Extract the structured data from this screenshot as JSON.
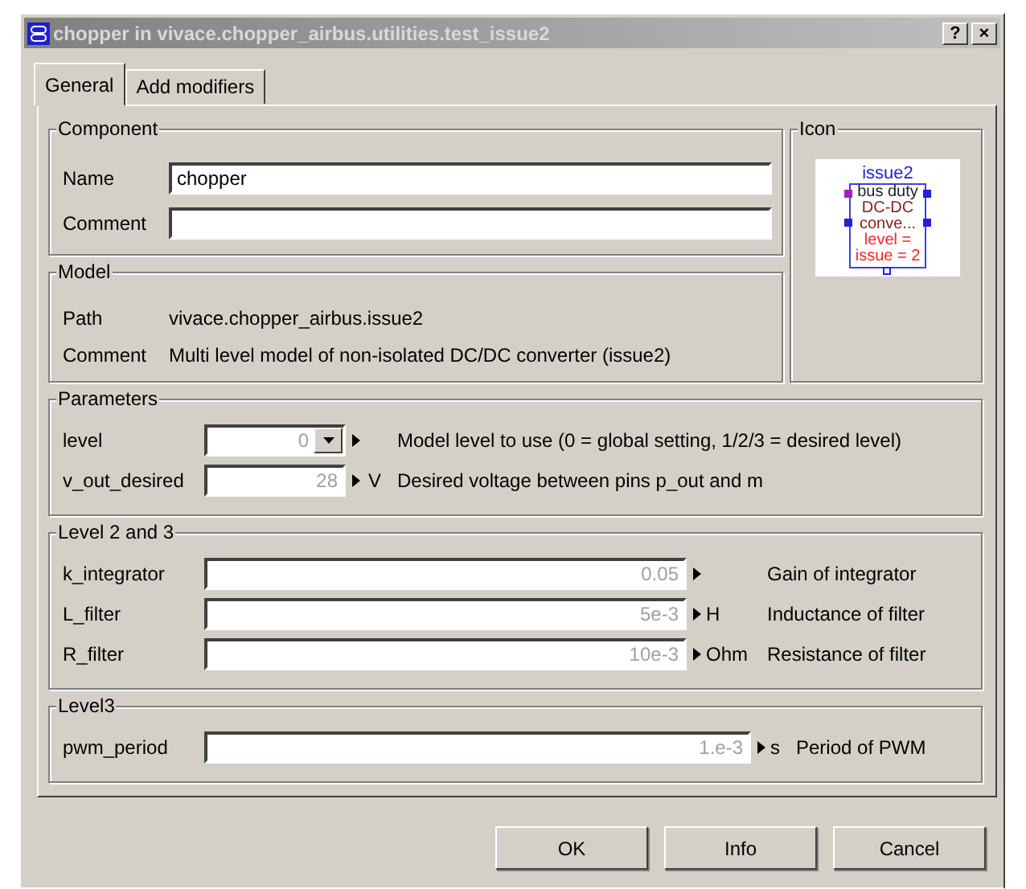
{
  "window": {
    "title": "chopper in vivace.chopper_airbus.utilities.test_issue2",
    "help": "?",
    "close": "×"
  },
  "tabs": [
    {
      "label": "General",
      "selected": true
    },
    {
      "label": "Add modifiers",
      "selected": false
    }
  ],
  "component": {
    "title": "Component",
    "fields": [
      {
        "label": "Name",
        "value": "chopper"
      },
      {
        "label": "Comment"
      }
    ]
  },
  "model": {
    "title": "Model",
    "rows": [
      {
        "label": "Path",
        "value": "vivace.chopper_airbus.issue2"
      },
      {
        "label": "Comment",
        "value": "Multi level model of non-isolated DC/DC converter (issue2)"
      }
    ]
  },
  "icon": {
    "title": "Icon",
    "caption": "issue2",
    "lines": [
      {
        "text": "bus duty",
        "color": "#222222"
      },
      {
        "text": "DC-DC",
        "color": "#8b1a1a"
      },
      {
        "text": "conve...",
        "color": "#8b1a1a"
      },
      {
        "text": "level =",
        "color": "#ff2020"
      },
      {
        "text": "issue = 2",
        "color": "#ff2020"
      }
    ]
  },
  "sections": [
    {
      "title": "Parameters",
      "rows": [
        {
          "kind": "dropdown",
          "name": "level",
          "placeholder": "0",
          "description": "Model level to use (0 = global setting, 1/2/3 = desired level)"
        },
        {
          "kind": "field",
          "name": "v_out_desired",
          "placeholder": "28",
          "unit": "V",
          "description": "Desired voltage between pins p_out and m"
        }
      ]
    },
    {
      "title": "Level 2 and 3",
      "rows": [
        {
          "kind": "field",
          "name": "k_integrator",
          "placeholder": "0.05",
          "description": "Gain of integrator"
        },
        {
          "kind": "field",
          "name": "L_filter",
          "placeholder": "5e-3",
          "unit": "H",
          "description": "Inductance of filter"
        },
        {
          "kind": "field",
          "name": "R_filter",
          "placeholder": "10e-3",
          "unit": "Ohm",
          "description": "Resistance of filter"
        }
      ]
    },
    {
      "title": "Level3",
      "rows": [
        {
          "kind": "field",
          "name": "pwm_period",
          "placeholder": "1.e-3",
          "unit": "s",
          "description": "Period of PWM"
        }
      ]
    }
  ],
  "buttons": [
    "OK",
    "Info",
    "Cancel"
  ]
}
